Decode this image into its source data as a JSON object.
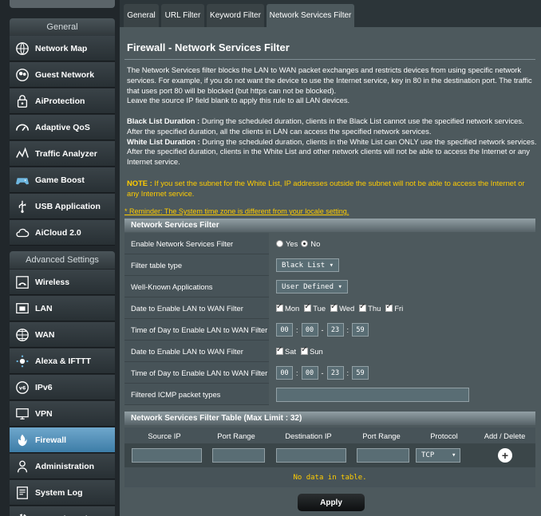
{
  "sidebar": {
    "general_header": "General",
    "advanced_header": "Advanced Settings",
    "general_items": [
      {
        "label": "Network Map",
        "icon": "network-map-icon"
      },
      {
        "label": "Guest Network",
        "icon": "guest-network-icon"
      },
      {
        "label": "AiProtection",
        "icon": "lock-icon"
      },
      {
        "label": "Adaptive QoS",
        "icon": "speedometer-icon"
      },
      {
        "label": "Traffic Analyzer",
        "icon": "traffic-analyzer-icon"
      },
      {
        "label": "Game Boost",
        "icon": "gamepad-icon"
      },
      {
        "label": "USB Application",
        "icon": "usb-icon"
      },
      {
        "label": "AiCloud 2.0",
        "icon": "cloud-icon"
      }
    ],
    "advanced_items": [
      {
        "label": "Wireless",
        "icon": "wireless-icon"
      },
      {
        "label": "LAN",
        "icon": "lan-icon"
      },
      {
        "label": "WAN",
        "icon": "globe-icon"
      },
      {
        "label": "Alexa & IFTTT",
        "icon": "alexa-icon"
      },
      {
        "label": "IPv6",
        "icon": "ipv6-icon"
      },
      {
        "label": "VPN",
        "icon": "vpn-icon"
      },
      {
        "label": "Firewall",
        "icon": "firewall-icon"
      },
      {
        "label": "Administration",
        "icon": "administration-icon"
      },
      {
        "label": "System Log",
        "icon": "system-log-icon"
      },
      {
        "label": "Network Tools",
        "icon": "network-tools-icon"
      }
    ],
    "active": "Firewall"
  },
  "tabs": [
    "General",
    "URL Filter",
    "Keyword Filter",
    "Network Services Filter"
  ],
  "active_tab": "Network Services Filter",
  "page_title": "Firewall - Network Services Filter",
  "intro": {
    "p1": "The Network Services filter blocks the LAN to WAN packet exchanges and restricts devices from using specific network services. For example, if you do not want the device to use the Internet service, key in 80 in the destination port. The traffic that uses port 80 will be blocked (but https can not be blocked).",
    "p2": "Leave the source IP field blank to apply this rule to all LAN devices.",
    "black_list_label": "Black List Duration :",
    "black_list_text": " During the scheduled duration, clients in the Black List cannot use the specified network services. After the specified duration, all the clients in LAN can access the specified network services.",
    "white_list_label": "White List Duration :",
    "white_list_text": " During the scheduled duration, clients in the White List can ONLY use the specified network services. After the specified duration, clients in the White List and other network clients will not be able to access the Internet or any Internet service.",
    "note_label": "NOTE :",
    "note_text": " If you set the subnet for the White List, IP addresses outside the subnet will not be able to access the Internet or any Internet service.",
    "reminder": "* Reminder: The System time zone is different from your locale setting."
  },
  "settings": {
    "header": "Network Services Filter",
    "enable_label": "Enable Network Services Filter",
    "yes": "Yes",
    "no": "No",
    "enabled": false,
    "filter_type_label": "Filter table type",
    "filter_type_value": "Black List",
    "well_known_label": "Well-Known Applications",
    "well_known_value": "User Defined",
    "date_weekdays_label": "Date to Enable LAN to WAN Filter",
    "weekdays": [
      "Mon",
      "Tue",
      "Wed",
      "Thu",
      "Fri"
    ],
    "time_weekdays_label": "Time of Day to Enable LAN to WAN Filter",
    "time_weekdays": {
      "h1": "00",
      "m1": "00",
      "h2": "23",
      "m2": "59"
    },
    "date_weekend_label": "Date to Enable LAN to WAN Filter",
    "weekend": [
      "Sat",
      "Sun"
    ],
    "time_weekend_label": "Time of Day to Enable LAN to WAN Filter",
    "time_weekend": {
      "h1": "00",
      "m1": "00",
      "h2": "23",
      "m2": "59"
    },
    "icmp_label": "Filtered ICMP packet types",
    "icmp_value": ""
  },
  "rules_table": {
    "header": "Network Services Filter Table (Max Limit : 32)",
    "columns": [
      "Source IP",
      "Port Range",
      "Destination IP",
      "Port Range",
      "Protocol",
      "Add / Delete"
    ],
    "protocol_value": "TCP",
    "empty_text": "No data in table."
  },
  "apply_label": "Apply"
}
